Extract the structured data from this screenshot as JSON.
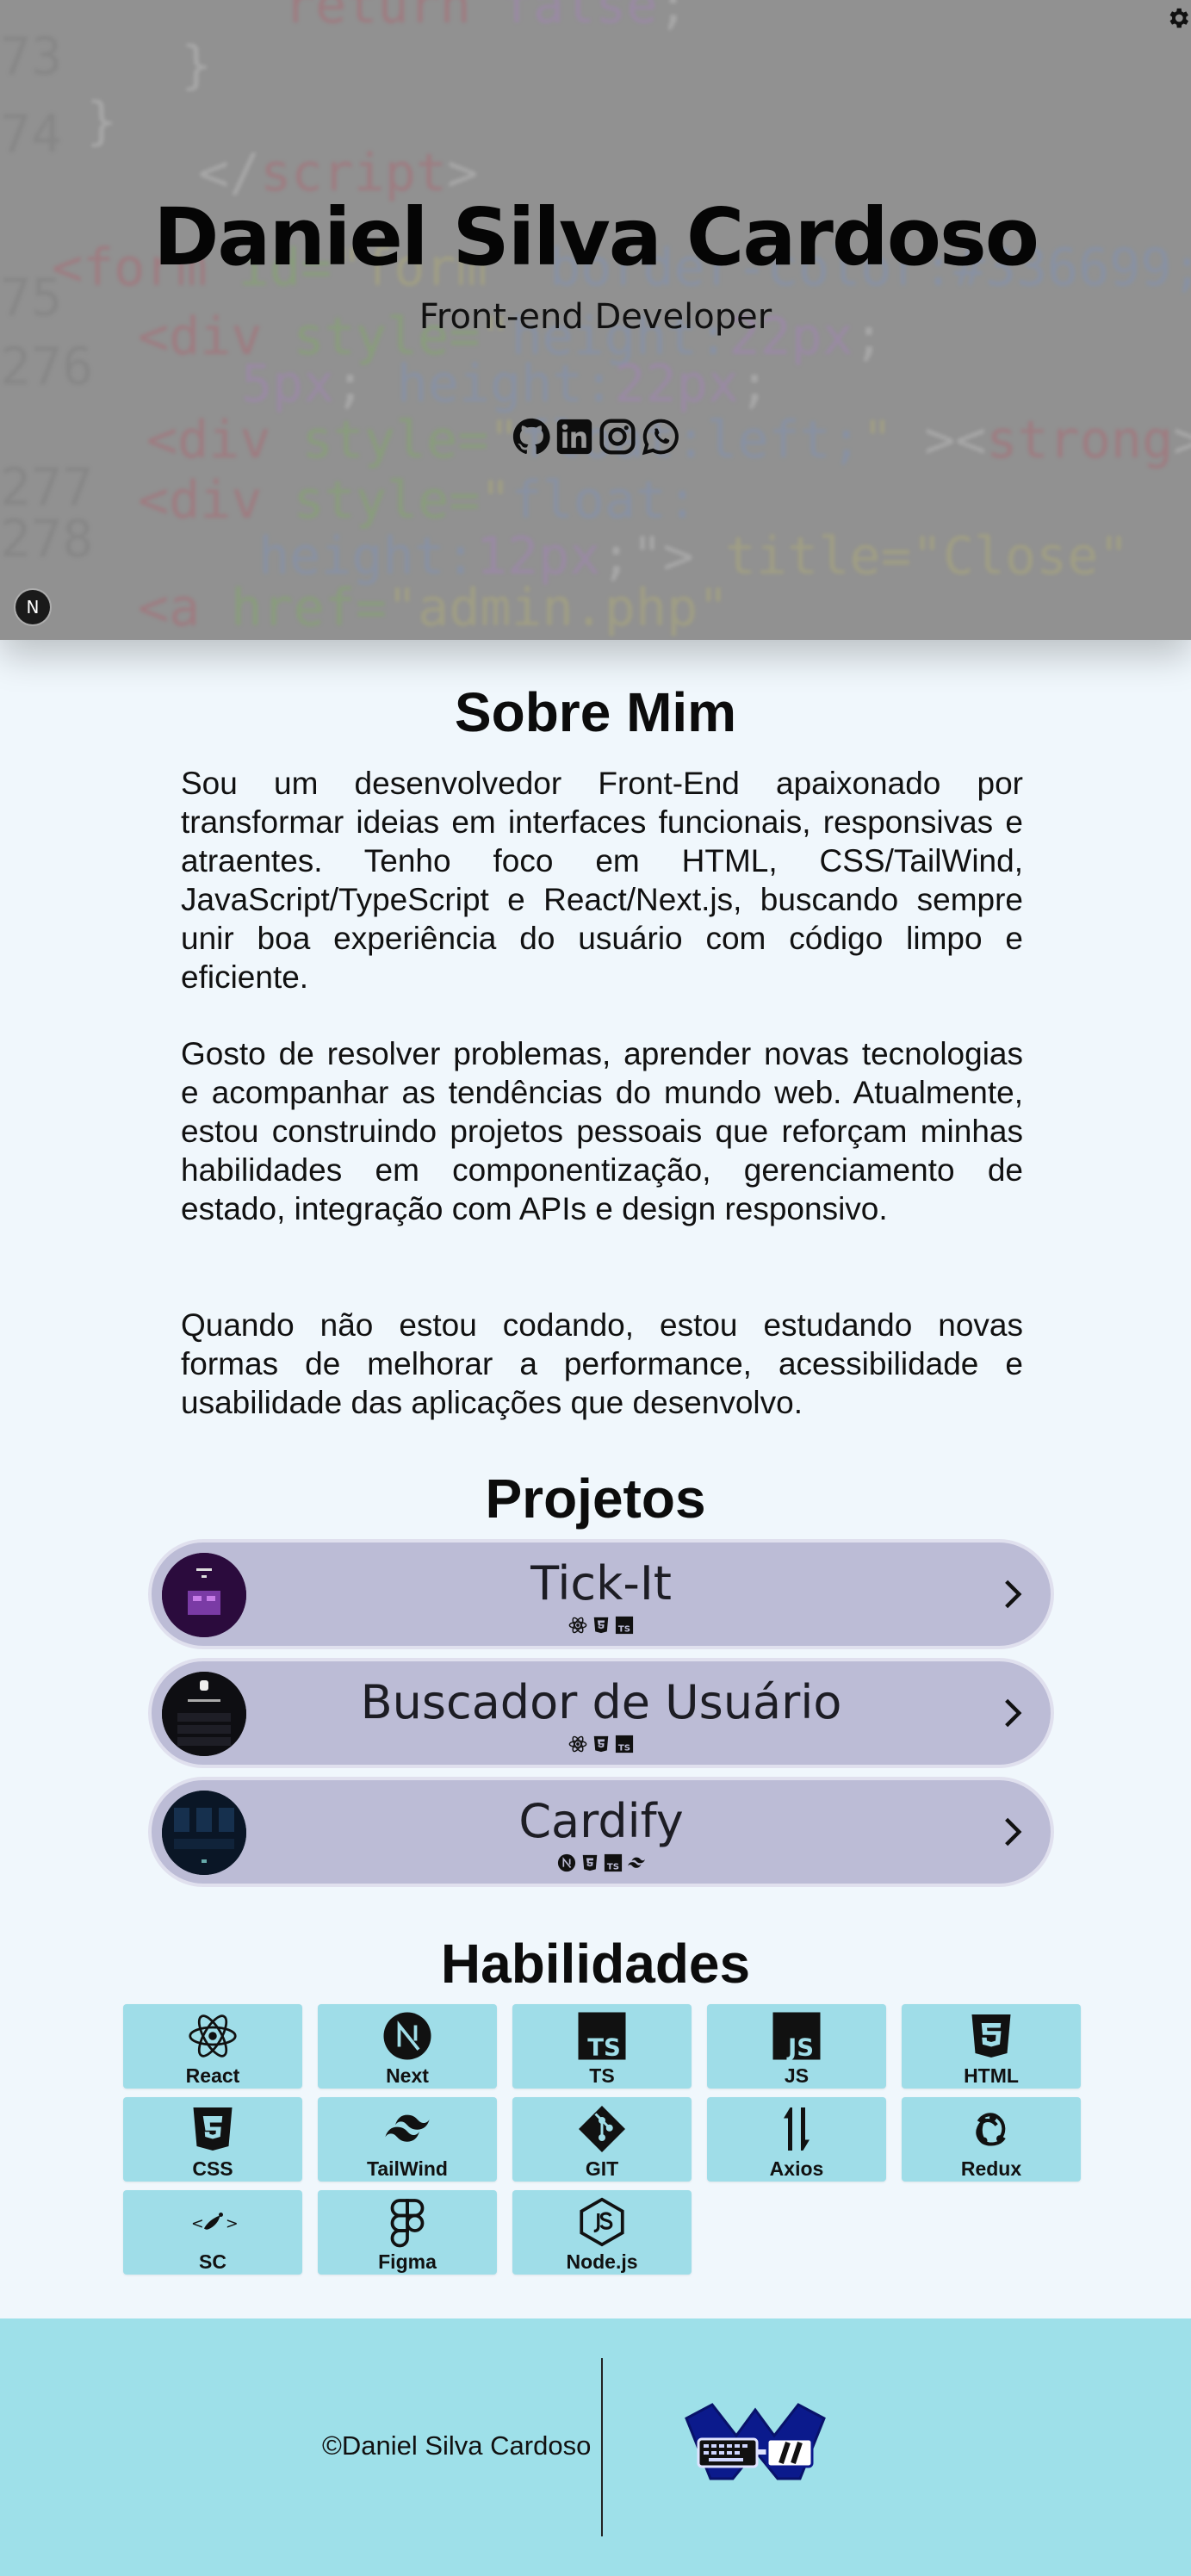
{
  "hero": {
    "name": "Daniel Silva Cardoso",
    "role": "Front-end Developer",
    "socials": [
      {
        "icon": "github-icon"
      },
      {
        "icon": "linkedin-icon"
      },
      {
        "icon": "instagram-icon"
      },
      {
        "icon": "whatsapp-icon"
      }
    ],
    "next_badge": "N"
  },
  "about": {
    "title": "Sobre Mim",
    "paragraphs": [
      "Sou um desenvolvedor Front-End apaixonado por transformar ideias em interfaces funcionais, responsivas e atraentes. Tenho foco em HTML, CSS/TailWind, JavaScript/TypeScript e React/Next.js, buscando sempre unir boa experiência do usuário com código limpo e eficiente.",
      "Gosto de resolver problemas, aprender novas tecnologias e acompanhar as tendências do mundo web. Atualmente, estou construindo projetos pessoais que reforçam minhas habilidades em componentização, gerenciamento de estado, integração com APIs e design responsivo.",
      "Quando não estou codando, estou estudando novas formas de melhorar a performance, acessibilidade e usabilidade das aplicações que desenvolvo."
    ]
  },
  "projects": {
    "title": "Projetos",
    "items": [
      {
        "name": "Tick-It",
        "tech": [
          "react-icon",
          "css-icon",
          "ts-icon"
        ]
      },
      {
        "name": "Buscador de Usuário",
        "tech": [
          "react-icon",
          "css-icon",
          "ts-icon"
        ]
      },
      {
        "name": "Cardify",
        "tech": [
          "next-icon",
          "css-icon",
          "ts-icon",
          "tailwind-icon"
        ]
      }
    ]
  },
  "skills": {
    "title": "Habilidades",
    "items": [
      {
        "label": "React",
        "icon": "react-icon"
      },
      {
        "label": "Next",
        "icon": "next-icon"
      },
      {
        "label": "TS",
        "icon": "ts-icon"
      },
      {
        "label": "JS",
        "icon": "js-icon"
      },
      {
        "label": "HTML",
        "icon": "html-icon"
      },
      {
        "label": "CSS",
        "icon": "css-icon"
      },
      {
        "label": "TailWind",
        "icon": "tailwind-icon"
      },
      {
        "label": "GIT",
        "icon": "git-icon"
      },
      {
        "label": "Axios",
        "icon": "axios-icon"
      },
      {
        "label": "Redux",
        "icon": "redux-icon"
      },
      {
        "label": "SC",
        "icon": "styled-components-icon"
      },
      {
        "label": "Figma",
        "icon": "figma-icon"
      },
      {
        "label": "Node.js",
        "icon": "nodejs-icon"
      }
    ]
  },
  "footer": {
    "copyright": "©Daniel Silva Cardoso"
  },
  "colors": {
    "page_bg": "#f0f7fc",
    "project_bg": "#bcbcd6",
    "skill_bg": "#9fdde8",
    "footer_bg": "#9ee0e9",
    "logo_navy": "#0b1a8c"
  }
}
